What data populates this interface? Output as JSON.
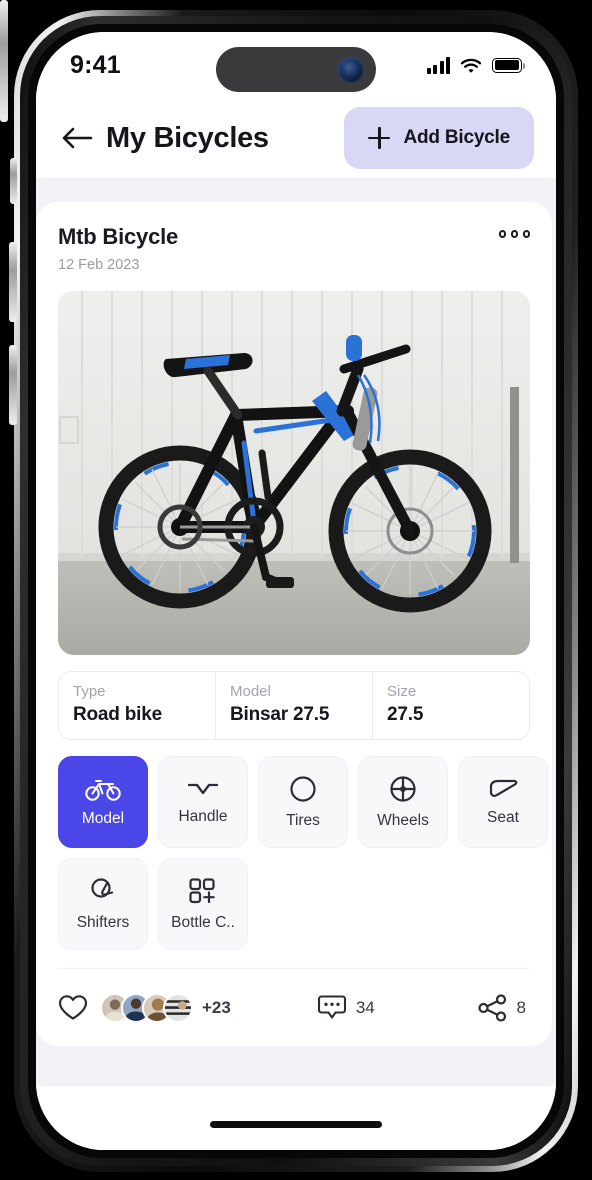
{
  "status_bar": {
    "time": "9:41",
    "signal_icon": "cellular-signal-icon",
    "wifi_icon": "wifi-icon",
    "battery_icon": "battery-full-icon"
  },
  "header": {
    "back_icon": "back-arrow-icon",
    "title": "My Bicycles",
    "add_button": {
      "label": "Add Bicycle",
      "icon": "plus-icon"
    }
  },
  "card": {
    "title": "Mtb Bicycle",
    "date": "12 Feb 2023",
    "more_icon": "more-options-icon",
    "photo_alt": "Black and blue Binsar mountain bicycle parked against a white corrugated wall",
    "specs": [
      {
        "key": "Type",
        "value": "Road bike"
      },
      {
        "key": "Model",
        "value": "Binsar 27.5"
      },
      {
        "key": "Size",
        "value": "27.5"
      }
    ],
    "chips": [
      {
        "label": "Model",
        "icon": "bicycle-icon",
        "active": true
      },
      {
        "label": "Handle",
        "icon": "handlebar-icon",
        "active": false
      },
      {
        "label": "Tires",
        "icon": "tire-icon",
        "active": false
      },
      {
        "label": "Wheels",
        "icon": "wheel-icon",
        "active": false
      },
      {
        "label": "Seat",
        "icon": "saddle-icon",
        "active": false
      },
      {
        "label": "Shifters",
        "icon": "shifter-icon",
        "active": false
      },
      {
        "label": "Bottle C..",
        "icon": "bottle-cage-icon",
        "active": false
      }
    ],
    "engagement": {
      "like_icon": "heart-icon",
      "likers_overflow": "+23",
      "comment_icon": "comment-bubble-icon",
      "comment_count": "34",
      "share_icon": "share-icon",
      "share_count": "8"
    }
  },
  "colors": {
    "accent": "#4a46e8",
    "accent_soft": "#d8d7f6",
    "page_bg": "#f3f2f8",
    "text": "#15151c",
    "muted": "#9b9ba5"
  }
}
